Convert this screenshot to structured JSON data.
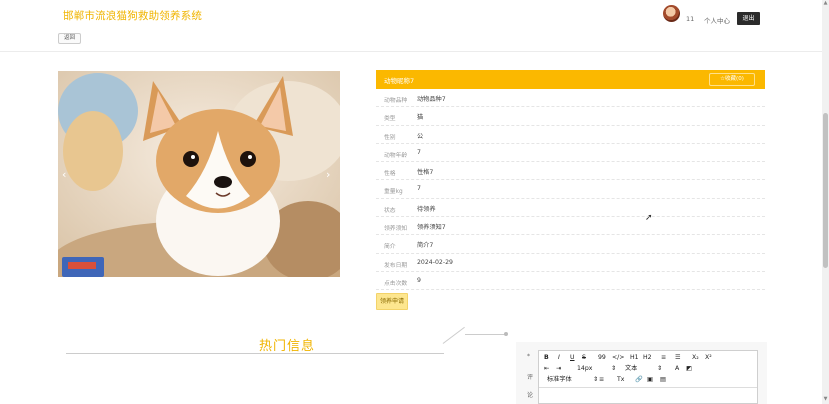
{
  "header": {
    "site_title": "邯郸市流浪猫狗救助领养系统",
    "username": "11",
    "user_center": "个人中心",
    "logout": "退出"
  },
  "back": {
    "label": "返回"
  },
  "carousel": {
    "prev": "‹",
    "next": "›"
  },
  "detail": {
    "title": "动物昵称7",
    "favorite": "☆收藏(0)",
    "rows": [
      {
        "label": "动物品种",
        "value": "动物品种7"
      },
      {
        "label": "类型",
        "value": "猫"
      },
      {
        "label": "性别",
        "value": "公"
      },
      {
        "label": "动物年龄",
        "value": "7"
      },
      {
        "label": "性格",
        "value": "性格7"
      },
      {
        "label": "重量kg",
        "value": "7"
      },
      {
        "label": "状态",
        "value": "待领养"
      },
      {
        "label": "领养须知",
        "value": "领养须知7"
      },
      {
        "label": "简介",
        "value": "简介7"
      },
      {
        "label": "发布日期",
        "value": "2024-02-29"
      },
      {
        "label": "点击次数",
        "value": "9"
      }
    ],
    "apply": "领养申请"
  },
  "hot": {
    "title": "热门信息"
  },
  "comment": {
    "side_labels": [
      "*",
      "评",
      "论"
    ],
    "toolbar": {
      "row1": [
        "B",
        "I",
        "U",
        "S",
        "99",
        "</>",
        "H1",
        "H2",
        "≡",
        "☰",
        "X₂",
        "X²"
      ],
      "row2": [
        "⇤",
        "⇥",
        "14px",
        "⇕",
        "文本",
        "⇕",
        "A",
        "◩"
      ],
      "row3": [
        "标准字体",
        "⇕",
        "≡",
        "Tx",
        "🔗",
        "▣",
        "▤"
      ]
    }
  }
}
